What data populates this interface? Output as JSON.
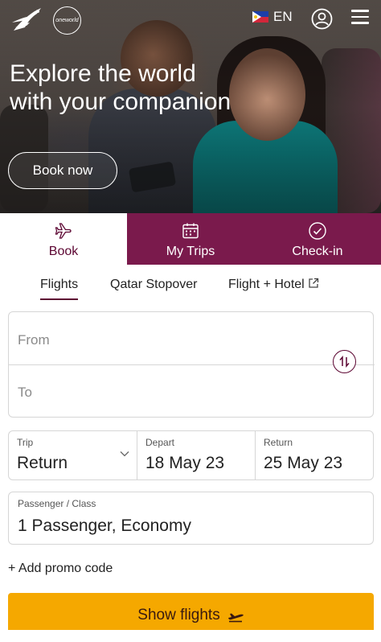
{
  "header": {
    "logo_icon": "qatar-airways-oryx-logo",
    "alliance_badge": "oneworld",
    "language": "EN",
    "flag_icon": "philippines-flag-icon",
    "profile_icon": "user-circle-icon",
    "menu_icon": "hamburger-menu-icon"
  },
  "hero": {
    "headline_line1": "Explore the world",
    "headline_line2": "with your companion",
    "cta_label": "Book now"
  },
  "main_tabs": [
    {
      "label": "Book",
      "icon": "airplane-icon",
      "active": true
    },
    {
      "label": "My Trips",
      "icon": "calendar-icon",
      "active": false
    },
    {
      "label": "Check-in",
      "icon": "check-circle-icon",
      "active": false
    }
  ],
  "sub_tabs": [
    {
      "label": "Flights",
      "active": true
    },
    {
      "label": "Qatar Stopover",
      "active": false
    },
    {
      "label": "Flight + Hotel",
      "external": true,
      "active": false
    }
  ],
  "form": {
    "from_placeholder": "From",
    "to_placeholder": "To",
    "trip_label": "Trip",
    "trip_value": "Return",
    "depart_label": "Depart",
    "depart_value": "18 May 23",
    "return_label": "Return",
    "return_value": "25 May 23",
    "pax_label": "Passenger / Class",
    "pax_value": "1 Passenger, Economy",
    "promo_label": "+ Add promo code",
    "submit_label": "Show flights"
  },
  "colors": {
    "brand_burgundy": "#5c0632",
    "tab_burgundy": "#7a1a4c",
    "cta_yellow": "#f5a800"
  }
}
